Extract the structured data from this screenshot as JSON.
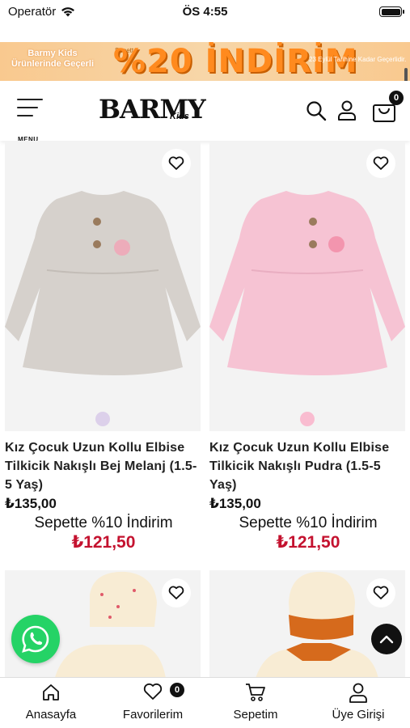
{
  "status_bar": {
    "carrier": "Operatör",
    "time": "ÖS 4:55"
  },
  "promo_banner": {
    "left_line1": "Barmy Kids",
    "left_line2": "Ürünlerinde Geçerli",
    "small_text": "Sepette",
    "headline": "%20 İNDİRİM",
    "right_text": "23 Eylül Tarihine Kadar Geçerlidir."
  },
  "header": {
    "menu_label": "MENU",
    "logo_text": "BARMY",
    "logo_sub": "Kids",
    "cart_count": "0"
  },
  "products": [
    {
      "name": "Kız Çocuk Uzun Kollu Elbise Tilkicik Nakışlı Bej Melanj (1.5-5 Yaş)",
      "price": "₺135,00",
      "discount_text": "Sepette %10 İndirim",
      "discount_price": "₺121,50",
      "dress_color": "#d6d1cc",
      "swatch_color": "#dcd0ea"
    },
    {
      "name": "Kız Çocuk Uzun Kollu Elbise Tilkicik Nakışlı Pudra (1.5-5 Yaş)",
      "price": "₺135,00",
      "discount_text": "Sepette %10 İndirim",
      "discount_price": "₺121,50",
      "dress_color": "#f6c3d3",
      "swatch_color": "#f9bcd0"
    }
  ],
  "tab_bar": {
    "items": [
      {
        "label": "Anasayfa",
        "icon": "home-icon"
      },
      {
        "label": "Favorilerim",
        "icon": "heart-icon",
        "badge": "0"
      },
      {
        "label": "Sepetim",
        "icon": "cart-icon"
      },
      {
        "label": "Üye Girişi",
        "icon": "user-icon"
      }
    ]
  },
  "colors": {
    "accent_red": "#c4122f",
    "whatsapp_green": "#25d366",
    "banner_orange": "#ff8a1e"
  }
}
